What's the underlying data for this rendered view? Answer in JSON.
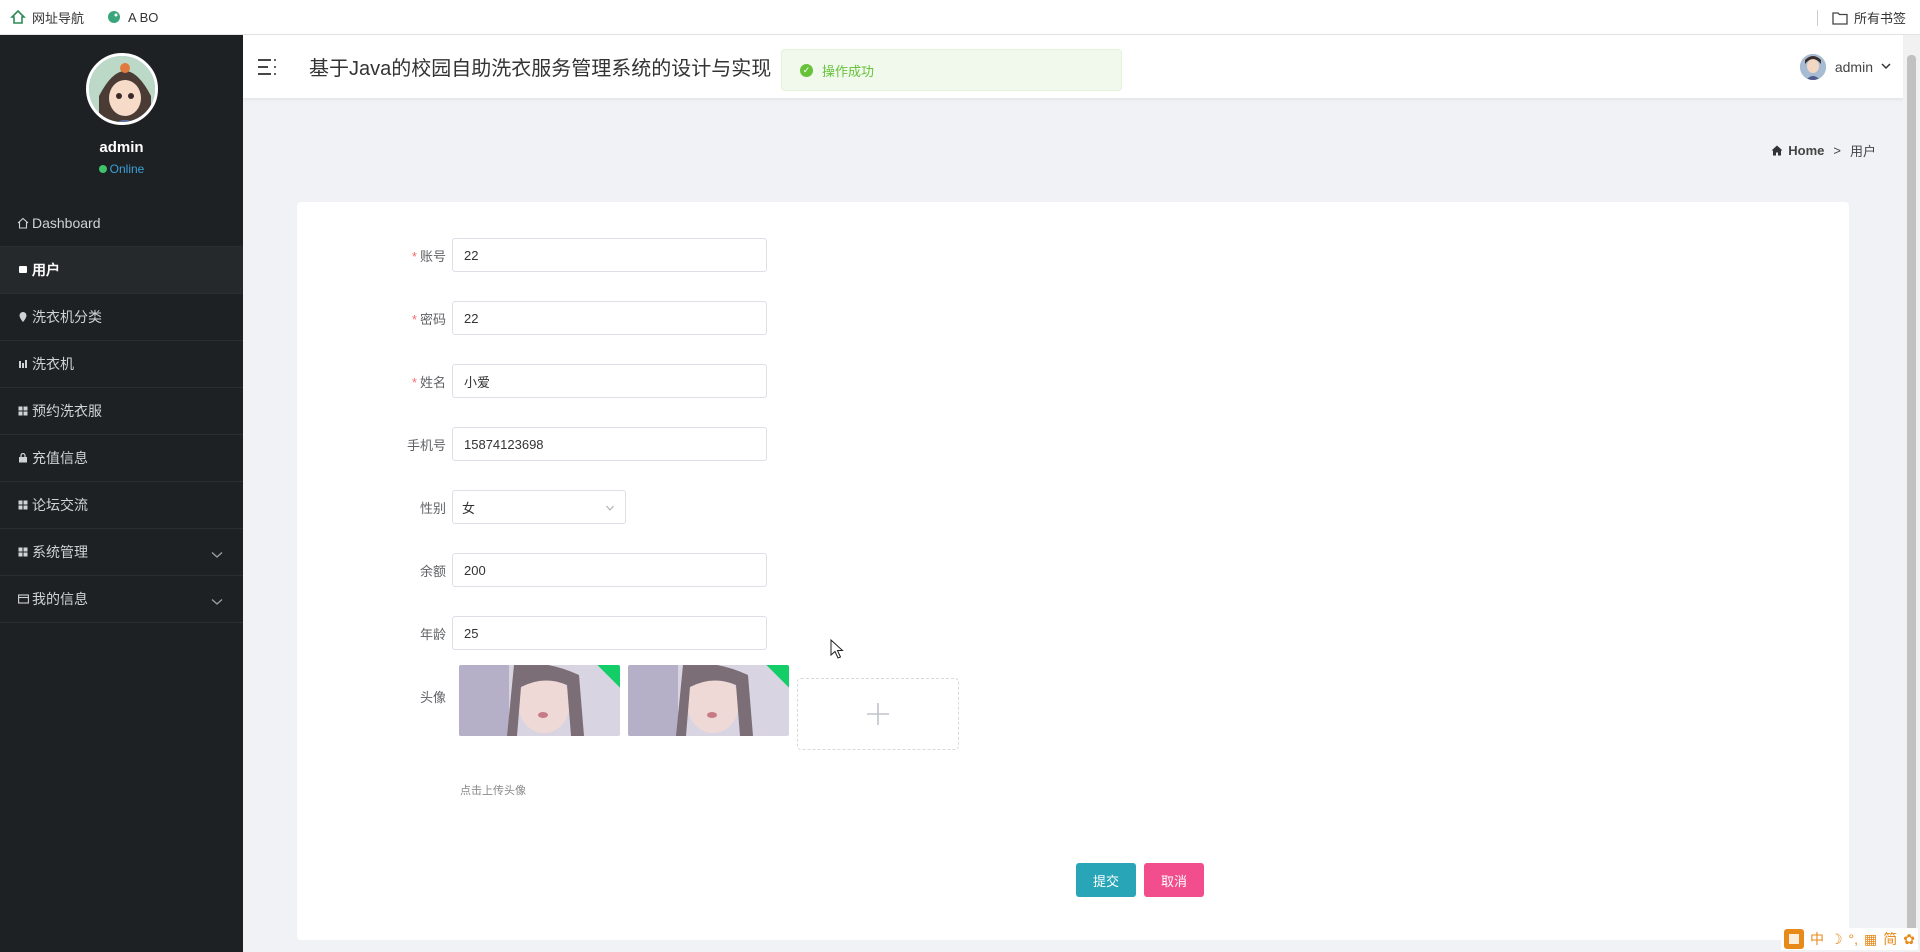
{
  "browser": {
    "bookmarks": [
      {
        "label": "网址导航",
        "icon": "house-icon"
      },
      {
        "label": "A BO",
        "icon": "bird-icon"
      }
    ],
    "all_bookmarks": "所有书签"
  },
  "sidebar": {
    "username": "admin",
    "status": "Online",
    "items": [
      {
        "label": "Dashboard",
        "icon": "home-icon"
      },
      {
        "label": "用户",
        "icon": "tag-icon"
      },
      {
        "label": "洗衣机分类",
        "icon": "pin-icon"
      },
      {
        "label": "洗衣机",
        "icon": "chart-icon"
      },
      {
        "label": "预约洗衣服",
        "icon": "grid-icon"
      },
      {
        "label": "充值信息",
        "icon": "lock-icon"
      },
      {
        "label": "论坛交流",
        "icon": "grid-icon"
      },
      {
        "label": "系统管理",
        "icon": "grid-icon"
      },
      {
        "label": "我的信息",
        "icon": "card-icon"
      }
    ]
  },
  "header": {
    "title": "基于Java的校园自助洗衣服务管理系统的设计与实现",
    "user": "admin"
  },
  "toast": {
    "message": "操作成功"
  },
  "breadcrumb": {
    "home": "Home",
    "separator": ">",
    "current": "用户"
  },
  "form": {
    "account": {
      "label": "账号",
      "value": "22",
      "required": true
    },
    "password": {
      "label": "密码",
      "value": "22",
      "required": true
    },
    "name": {
      "label": "姓名",
      "value": "小爱",
      "required": true
    },
    "phone": {
      "label": "手机号",
      "value": "15874123698"
    },
    "gender": {
      "label": "性别",
      "value": "女"
    },
    "balance": {
      "label": "余额",
      "value": "200"
    },
    "age": {
      "label": "年龄",
      "value": "25"
    },
    "avatar": {
      "label": "头像",
      "hint": "点击上传头像",
      "uploaded_count": 2
    },
    "submit": "提交",
    "cancel": "取消",
    "required_mark": "*"
  },
  "ime": {
    "items": [
      "中",
      "简"
    ]
  },
  "colors": {
    "sidebar_bg": "#1e2124",
    "submit": "#28a6b8",
    "cancel": "#f24e8d",
    "toast_text": "#67c23a"
  }
}
